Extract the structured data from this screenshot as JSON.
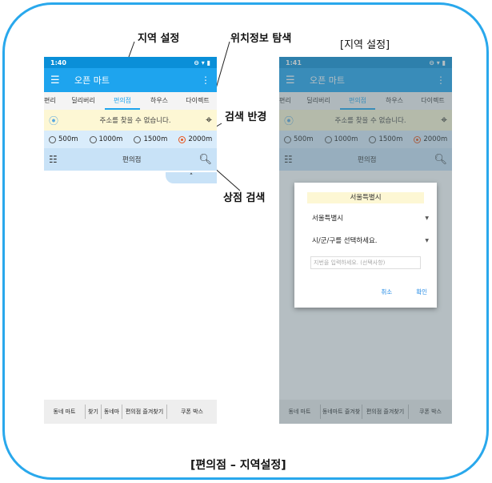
{
  "callouts": {
    "region_setting": "지역 설정",
    "location_search": "위치정보 탐색",
    "search_radius": "검색 반경",
    "store_search": "상점 검색",
    "right_caption": "[지역 설정]",
    "bottom_caption": "[편의점 – 지역설정]"
  },
  "left_phone": {
    "status_time": "1:40",
    "status_icons": "⊖ ▾ ▮",
    "app_title": "오픈 마트",
    "tabs": [
      "편리",
      "딜리버리",
      "편의점",
      "하우스",
      "다이렉트"
    ],
    "active_tab": 2,
    "address_text": "주소를 찾을 수 없습니다.",
    "radii": [
      "500m",
      "1000m",
      "1500m",
      "2000m"
    ],
    "selected_radius": 3,
    "search_label": "편의점",
    "collapse_glyph": "˄",
    "bottom_nav": [
      "동네 마트",
      "찾기",
      "동네마",
      "편의점 즐겨찾기",
      "쿠폰 박스"
    ]
  },
  "right_phone": {
    "status_time": "1:41",
    "status_icons": "⊖ ▾ ▮",
    "app_title": "오픈 마트",
    "tabs": [
      "편리",
      "딜리버리",
      "편의점",
      "하우스",
      "다이렉트"
    ],
    "active_tab": 2,
    "address_text": "주소를 찾을 수 없습니다.",
    "radii": [
      "500m",
      "1000m",
      "1500m",
      "2000m"
    ],
    "selected_radius": 3,
    "search_label": "편의점",
    "bottom_nav": [
      "동네 마트",
      "동네마트 즐겨찾",
      "편의점 즐겨찾기",
      "쿠폰 박스"
    ],
    "dialog": {
      "title": "서울특별시",
      "city_select": "서울특별시",
      "district_select": "시/군/구를 선택하세요.",
      "address_placeholder": "지번을 입력하세요. (선택사항)",
      "cancel": "취소",
      "confirm": "확인"
    }
  },
  "colors": {
    "accent": "#1ea4ee",
    "frame": "#29a8ec",
    "selected_radio": "#e8541d"
  }
}
